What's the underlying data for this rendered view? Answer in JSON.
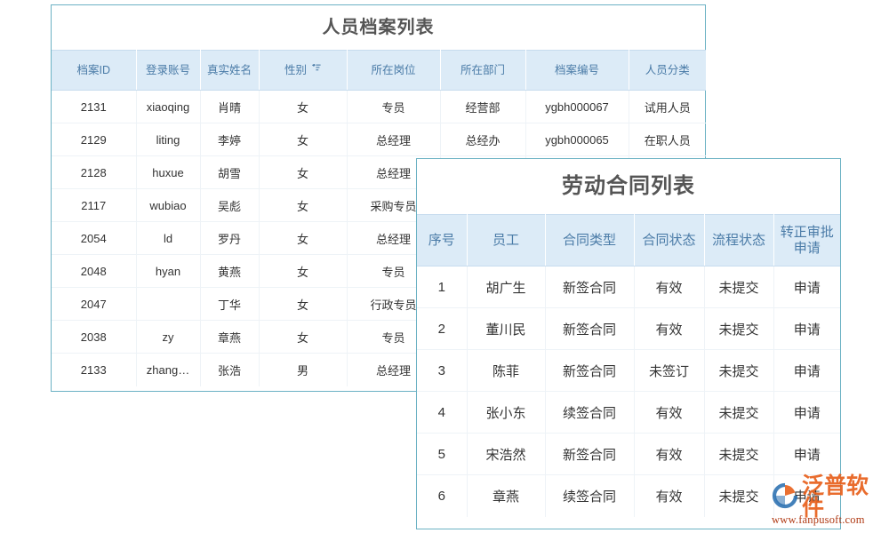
{
  "colors": {
    "panel_border": "#6cb2c4",
    "header_bg": "#dcebf7",
    "header_text": "#4a7ba7",
    "link": "#3a8bd5",
    "title_text": "#555555",
    "watermark_orange": "#e8601c",
    "watermark_blue": "#2a6fb0"
  },
  "personnel_panel": {
    "title": "人员档案列表",
    "columns": [
      {
        "label": "档案ID",
        "sort": false
      },
      {
        "label": "登录账号",
        "sort": false
      },
      {
        "label": "真实姓名",
        "sort": false
      },
      {
        "label": "性别",
        "sort": true
      },
      {
        "label": "所在岗位",
        "sort": false
      },
      {
        "label": "所在部门",
        "sort": false
      },
      {
        "label": "档案编号",
        "sort": false
      },
      {
        "label": "人员分类",
        "sort": false
      }
    ],
    "rows": [
      {
        "id": "2131",
        "account": "xiaoqing",
        "name": "肖晴",
        "gender": "女",
        "post": "专员",
        "dept": "经营部",
        "code": "ygbh000067",
        "category": "试用人员"
      },
      {
        "id": "2129",
        "account": "liting",
        "name": "李婷",
        "gender": "女",
        "post": "总经理",
        "dept": "总经办",
        "code": "ygbh000065",
        "category": "在职人员"
      },
      {
        "id": "2128",
        "account": "huxue",
        "name": "胡雪",
        "gender": "女",
        "post": "总经理",
        "dept": "",
        "code": "",
        "category": ""
      },
      {
        "id": "2117",
        "account": "wubiao",
        "name": "吴彪",
        "gender": "女",
        "post": "采购专员",
        "dept": "",
        "code": "",
        "category": ""
      },
      {
        "id": "2054",
        "account": "ld",
        "name": "罗丹",
        "gender": "女",
        "post": "总经理",
        "dept": "",
        "code": "",
        "category": ""
      },
      {
        "id": "2048",
        "account": "hyan",
        "name": "黄燕",
        "gender": "女",
        "post": "专员",
        "dept": "",
        "code": "",
        "category": ""
      },
      {
        "id": "2047",
        "account": "",
        "name": "丁华",
        "gender": "女",
        "post": "行政专员",
        "dept": "",
        "code": "",
        "category": ""
      },
      {
        "id": "2038",
        "account": "zy",
        "name": "章燕",
        "gender": "女",
        "post": "专员",
        "dept": "",
        "code": "",
        "category": ""
      },
      {
        "id": "2133",
        "account": "zhang…",
        "name": "张浩",
        "gender": "男",
        "post": "总经理",
        "dept": "",
        "code": "",
        "category": ""
      }
    ]
  },
  "contract_panel": {
    "title": "劳动合同列表",
    "columns": [
      {
        "label": "序号"
      },
      {
        "label": "员工"
      },
      {
        "label": "合同类型"
      },
      {
        "label": "合同状态"
      },
      {
        "label": "流程状态"
      },
      {
        "label": "转正审批申请"
      }
    ],
    "rows": [
      {
        "seq": "1",
        "employee": "胡广生",
        "contract_type": "新签合同",
        "contract_status": "有效",
        "flow_status": "未提交",
        "action": "申请"
      },
      {
        "seq": "2",
        "employee": "董川民",
        "contract_type": "新签合同",
        "contract_status": "有效",
        "flow_status": "未提交",
        "action": "申请"
      },
      {
        "seq": "3",
        "employee": "陈菲",
        "contract_type": "新签合同",
        "contract_status": "未签订",
        "flow_status": "未提交",
        "action": "申请"
      },
      {
        "seq": "4",
        "employee": "张小东",
        "contract_type": "续签合同",
        "contract_status": "有效",
        "flow_status": "未提交",
        "action": "申请"
      },
      {
        "seq": "5",
        "employee": "宋浩然",
        "contract_type": "新签合同",
        "contract_status": "有效",
        "flow_status": "未提交",
        "action": "申请"
      },
      {
        "seq": "6",
        "employee": "章燕",
        "contract_type": "续签合同",
        "contract_status": "有效",
        "flow_status": "未提交",
        "action": "申请"
      }
    ]
  },
  "watermark": {
    "brand": "泛普软件",
    "url": "www.fanpusoft.com"
  }
}
